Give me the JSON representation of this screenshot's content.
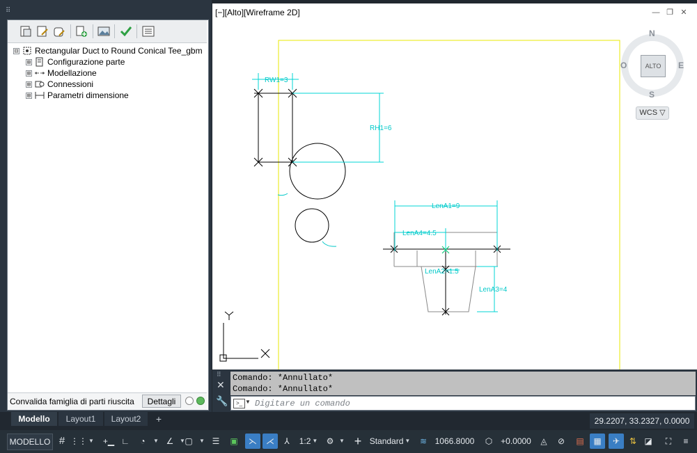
{
  "palette": {
    "grip": "⠿",
    "tree": [
      {
        "label": "Rectangular Duct to Round Conical Tee_gbm",
        "expander": "⊟",
        "icon": "part-root-icon"
      },
      {
        "label": "Configurazione parte",
        "expander": "⊞",
        "icon": "part-config-icon"
      },
      {
        "label": "Modellazione",
        "expander": "⊞",
        "icon": "modeling-icon"
      },
      {
        "label": "Connessioni",
        "expander": "⊞",
        "icon": "connections-icon"
      },
      {
        "label": "Parametri dimensione",
        "expander": "⊞",
        "icon": "dimension-parameters-icon"
      }
    ],
    "status_text": "Convalida famiglia di parti riuscita",
    "details_button": "Dettagli"
  },
  "viewport": {
    "label": "[−][Alto][Wireframe 2D]",
    "viewcube": {
      "n": "N",
      "s": "S",
      "e": "E",
      "w": "O",
      "face": "ALTO"
    },
    "wcs": "WCS ▽",
    "ucs_y": "Y",
    "ucs_x": "X",
    "dimensions": {
      "rw1": "RW1=3",
      "rh1": "RH1=6",
      "lena1": "LenA1=9",
      "lena4": "LenA4=4.5",
      "lena2": "LenA2=1.5",
      "lena3": "LenA3=4"
    }
  },
  "command": {
    "history": [
      "Comando: *Annullato*",
      "Comando: *Annullato*"
    ],
    "placeholder": "Digitare un comando"
  },
  "layout_tabs": [
    "Modello",
    "Layout1",
    "Layout2",
    "+"
  ],
  "coordinates": "29.2207, 33.2327, 0.0000",
  "statusbar": {
    "model": "MODELLO",
    "scale": "1:2",
    "style": "Standard",
    "elevation": "1066.8000",
    "offset": "+0.0000"
  },
  "colors": {
    "cyan_dim": "#00e5e5",
    "yellow_border": "#f2f200",
    "accent": "#3a7ec4"
  }
}
